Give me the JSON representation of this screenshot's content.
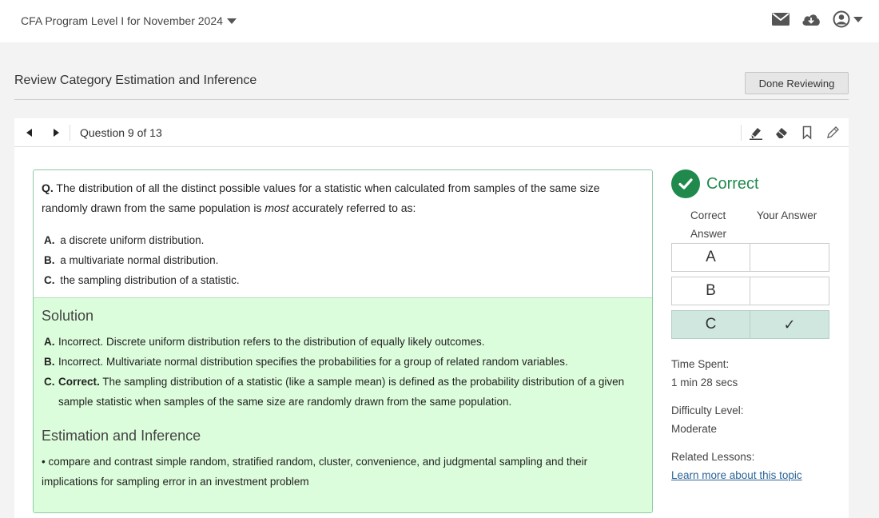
{
  "header": {
    "program_label": "CFA Program Level I for November 2024",
    "icons": [
      "envelope-icon",
      "cloud-download-icon",
      "user-account-icon"
    ]
  },
  "review": {
    "title": "Review Category Estimation and Inference",
    "done_button": "Done Reviewing"
  },
  "question_nav": {
    "counter": "Question 9 of 13",
    "tools": [
      "highlighter-icon",
      "eraser-icon",
      "bookmark-icon",
      "pencil-icon"
    ]
  },
  "question": {
    "prefix": "Q.",
    "text_before": " The distribution of all the distinct possible values for a statistic when calculated from samples of the same size randomly drawn from the same population is ",
    "emphasis": "most",
    "text_after": " accurately referred to as:",
    "options": [
      {
        "letter": "A.",
        "text": "a discrete uniform distribution."
      },
      {
        "letter": "B.",
        "text": "a multivariate normal distribution."
      },
      {
        "letter": "C.",
        "text": "the sampling distribution of a statistic."
      }
    ]
  },
  "solution": {
    "heading": "Solution",
    "lines": [
      {
        "letter": "A.",
        "bold": "",
        "text": "Incorrect. Discrete uniform distribution refers to the distribution of equally likely outcomes."
      },
      {
        "letter": "B.",
        "bold": "",
        "text": "Incorrect. Multivariate normal distribution specifies the probabilities for a group of related random variables."
      },
      {
        "letter": "C.",
        "bold": "Correct.",
        "text": " The sampling distribution of a statistic (like a sample mean) is defined as the probability distribution of a given sample statistic when samples of the same size are randomly drawn from the same population."
      }
    ],
    "topic_heading": "Estimation and Inference",
    "topic_text": "• compare and contrast simple random, stratified random, cluster, convenience, and judgmental sampling and their implications for sampling error in an investment problem"
  },
  "result": {
    "status": "Correct",
    "correct_answer_header": "Correct Answer",
    "your_answer_header": "Your Answer",
    "rows": [
      {
        "option": "A",
        "your_mark": ""
      },
      {
        "option": "B",
        "your_mark": ""
      },
      {
        "option": "C",
        "your_mark": "✓"
      }
    ],
    "time_spent_label": "Time Spent:",
    "time_spent_value": "1 min 28 secs",
    "difficulty_label": "Difficulty Level:",
    "difficulty_value": "Moderate",
    "related_label": "Related Lessons:",
    "related_link": "Learn more about this topic",
    "colors": {
      "correct_green": "#1f8a4c",
      "solution_bg": "#dcfddc",
      "highlight_row": "#cfe7df"
    }
  }
}
